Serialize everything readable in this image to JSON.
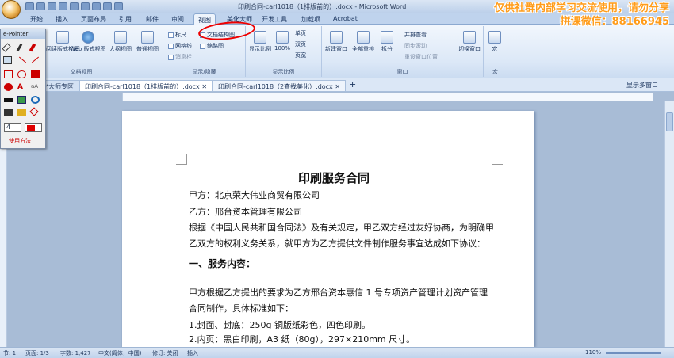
{
  "window": {
    "title": "印刷合同-carl1018（1排版前的）.docx - Microsoft Word",
    "watermark_line1": "仅供社群内部学习交流使用，请勿分享",
    "watermark_line2": "拼课微信：88166945"
  },
  "ribbon_tabs": [
    "开始",
    "插入",
    "页面布局",
    "引用",
    "邮件",
    "审阅",
    "视图",
    "美化大师",
    "开发工具",
    "加载项",
    "Acrobat"
  ],
  "active_tab": "视图",
  "ribbon": {
    "doc_views": {
      "label": "文档视图",
      "buttons": [
        "阅读版式视图",
        "Web 版式视图",
        "大纲视图",
        "普通视图"
      ]
    },
    "show_hide": {
      "label": "显示/隐藏",
      "checks": [
        "标尺",
        "网格线",
        "消息栏",
        "文档结构图",
        "缩略图"
      ]
    },
    "zoom": {
      "label": "显示比例",
      "buttons": [
        "显示比例",
        "100%"
      ],
      "page_buttons": [
        "单页",
        "双页",
        "页宽"
      ]
    },
    "window": {
      "label": "窗口",
      "buttons": [
        "新建窗口",
        "全部重排",
        "拆分"
      ],
      "small": [
        "并排查看",
        "同步滚动",
        "重设窗口位置"
      ],
      "switch": "切换窗口"
    },
    "macro": {
      "label": "宏",
      "button": "宏"
    }
  },
  "doc_tabs": {
    "left_label": "美化大师专区",
    "tabs": [
      "印刷合同-carl1018（1排版前的）.docx",
      "印刷合同-carl1018（2查找美化）.docx"
    ],
    "add": "+",
    "right_label": "显示多窗口"
  },
  "document": {
    "title": "印刷服务合同",
    "lines": [
      "甲方：北京荣大伟业商贸有限公司",
      "乙方：邢台资本管理有限公司",
      "根据《中国人民共和国合同法》及有关规定，甲乙双方经过友好协商，为明确甲",
      "乙双方的权利义务关系，就甲方为乙方提供文件制作服务事宜达成如下协议：",
      "一、服务内容：",
      "甲方根据乙方提出的要求为乙方邢台资本惠信 1 号专项资产管理计划资产管理",
      "合同制作，具体标准如下：",
      "1.封面、封底：250g 铜版纸彩色，四色印刷。",
      "2.内页：黑白印刷，A3 纸（80g），297×210mm 尺寸。"
    ]
  },
  "status": {
    "section": "节: 1",
    "page": "页面: 1/3",
    "words": "字数: 1,427",
    "lang": "中文(简体，中国)",
    "track": "修订: 关闭",
    "mode": "插入",
    "zoom": "110%"
  },
  "epointer": {
    "title": "e-Pointer",
    "help": "使用方法",
    "size": "4"
  },
  "colors": {
    "accent": "#e00000",
    "watermark": "#ff9c1a"
  }
}
